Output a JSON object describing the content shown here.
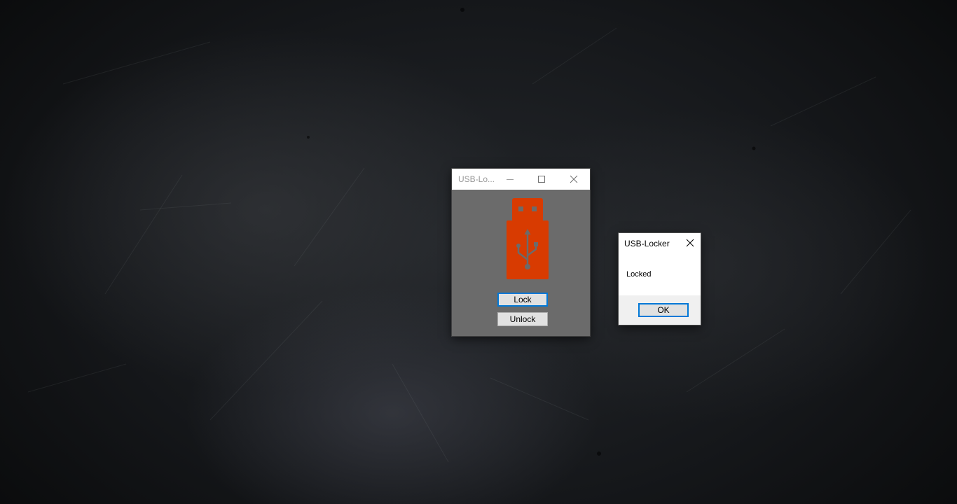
{
  "main_window": {
    "title": "USB-Lo...",
    "controls": {
      "minimize": "minimize-icon",
      "maximize": "maximize-icon",
      "close": "close-icon"
    },
    "logo": "usb-drive-icon",
    "buttons": {
      "lock": "Lock",
      "unlock": "Unlock"
    },
    "colors": {
      "background": "#6b6b6b",
      "logo": "#d83b01",
      "accent": "#0078d7"
    }
  },
  "message_box": {
    "title": "USB-Locker",
    "message": "Locked",
    "ok": "OK",
    "close": "close-icon"
  }
}
